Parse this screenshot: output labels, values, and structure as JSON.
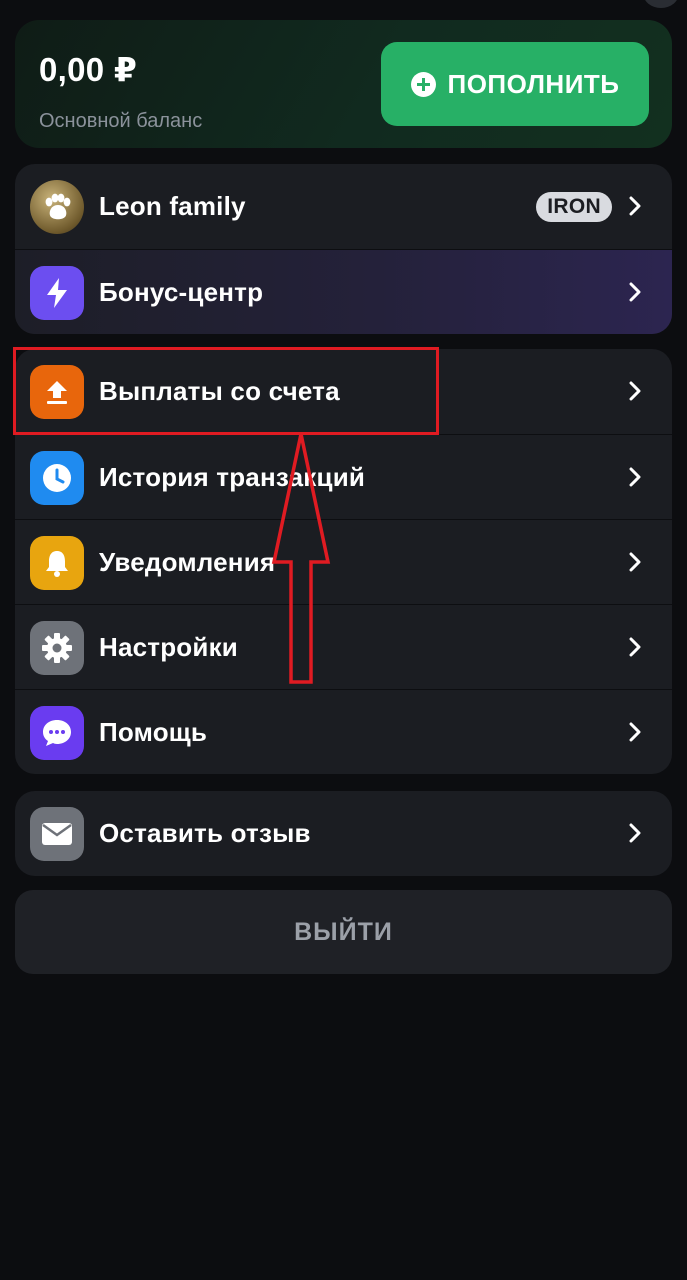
{
  "balance": {
    "amount": "0,00 ₽",
    "label": "Основной баланс",
    "topup_label": "ПОПОЛНИТЬ"
  },
  "group1": {
    "items": [
      {
        "label": "Leon family",
        "badge": "IRON",
        "icon": "paw-icon",
        "icon_color": "#8a7340"
      },
      {
        "label": "Бонус-центр",
        "icon": "lightning-icon",
        "icon_color": "#6c4ef0"
      }
    ]
  },
  "group2": {
    "items": [
      {
        "label": "Выплаты со счета",
        "icon": "upload-icon",
        "icon_color": "#e8660c"
      },
      {
        "label": "История транзакций",
        "icon": "clock-icon",
        "icon_color": "#1f8bf0"
      },
      {
        "label": "Уведомления",
        "icon": "bell-icon",
        "icon_color": "#e8a50f"
      },
      {
        "label": "Настройки",
        "icon": "gear-icon",
        "icon_color": "#6e7279"
      },
      {
        "label": "Помощь",
        "icon": "chat-icon",
        "icon_color": "#6a3cf0"
      }
    ]
  },
  "group3": {
    "items": [
      {
        "label": "Оставить отзыв",
        "icon": "mail-icon",
        "icon_color": "#6e7279"
      }
    ]
  },
  "logout_label": "ВЫЙТИ",
  "colors": {
    "accent_green": "#27b066",
    "annotation_red": "#e01b22",
    "background": "#0c0d10",
    "card": "#1b1d22"
  }
}
